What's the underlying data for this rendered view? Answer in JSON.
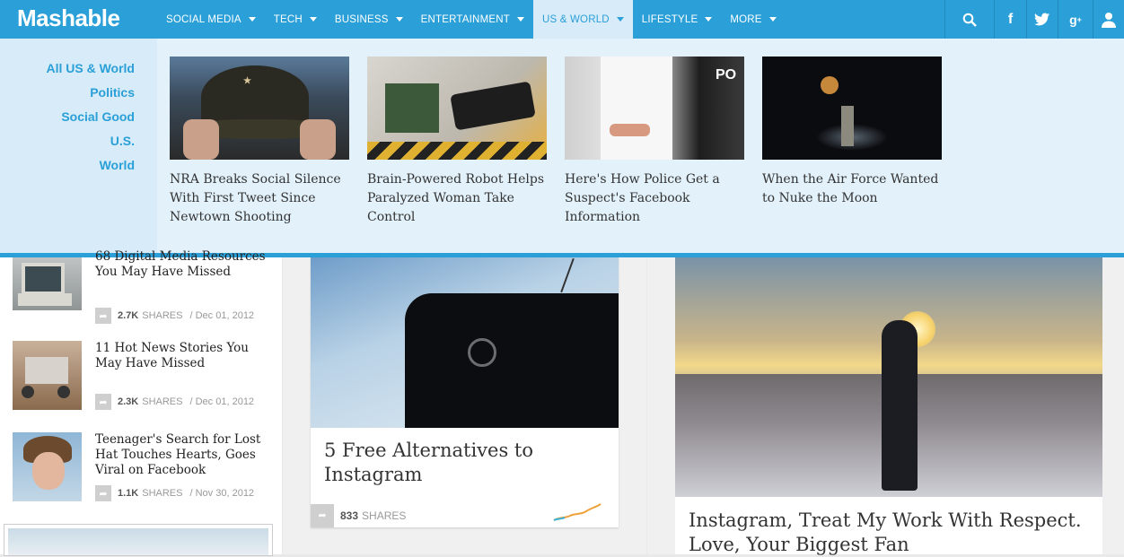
{
  "brand": {
    "logo": "Mashable"
  },
  "nav": {
    "items": [
      {
        "label": "SOCIAL MEDIA"
      },
      {
        "label": "TECH"
      },
      {
        "label": "BUSINESS"
      },
      {
        "label": "ENTERTAINMENT"
      },
      {
        "label": "US & WORLD",
        "active": true
      },
      {
        "label": "LIFESTYLE"
      },
      {
        "label": "MORE"
      }
    ],
    "icons": [
      "search-icon",
      "facebook-icon",
      "twitter-icon",
      "google-plus-icon",
      "user-icon"
    ]
  },
  "dropdown": {
    "links": [
      "All US & World",
      "Politics",
      "Social Good",
      "U.S.",
      "World"
    ],
    "stories": [
      {
        "title": "NRA Breaks Social Silence With First Tweet Since Newtown Shooting"
      },
      {
        "title": "Brain-Powered Robot Helps Paralyzed Woman Take Control"
      },
      {
        "title": "Here's How Police Get a Suspect's Facebook Information"
      },
      {
        "title": "When the Air Force Wanted to Nuke the Moon"
      }
    ]
  },
  "sidebar_list": [
    {
      "title": "68 Digital Media Resources You May Have Missed",
      "shares": "2.7K",
      "shares_label": "SHARES",
      "date": "/ Dec 01, 2012"
    },
    {
      "title": "11 Hot News Stories You May Have Missed",
      "shares": "2.3K",
      "shares_label": "SHARES",
      "date": "/ Dec 01, 2012"
    },
    {
      "title": "Teenager's Search for Lost Hat Touches Hearts, Goes Viral on Facebook",
      "shares": "1.1K",
      "shares_label": "SHARES",
      "date": "/ Nov 30, 2012"
    }
  ],
  "mid_card": {
    "title": "5 Free Alternatives to Instagram",
    "shares": "833",
    "shares_label": "SHARES"
  },
  "right_card": {
    "title": "Instagram, Treat My Work With Respect. Love, Your Biggest Fan"
  },
  "colors": {
    "brand_blue": "#2a9fd8",
    "dropdown_bg": "#d7ecf8"
  }
}
